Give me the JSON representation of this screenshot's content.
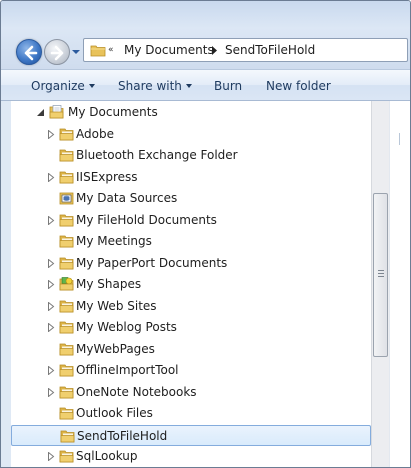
{
  "address": {
    "segments": [
      "My Documents",
      "SendToFileHold"
    ]
  },
  "toolbar": {
    "organize": "Organize",
    "share_with": "Share with",
    "burn": "Burn",
    "new_folder": "New folder"
  },
  "tree": {
    "root": "My Documents",
    "items": [
      {
        "label": "Adobe",
        "expandable": true,
        "icon": "folder-icon"
      },
      {
        "label": "Bluetooth Exchange Folder",
        "expandable": false,
        "icon": "folder-icon"
      },
      {
        "label": "IISExpress",
        "expandable": true,
        "icon": "folder-icon"
      },
      {
        "label": "My Data Sources",
        "expandable": false,
        "icon": "data-sources-icon"
      },
      {
        "label": "My FileHold Documents",
        "expandable": true,
        "icon": "folder-icon"
      },
      {
        "label": "My Meetings",
        "expandable": false,
        "icon": "folder-icon"
      },
      {
        "label": "My PaperPort Documents",
        "expandable": true,
        "icon": "folder-icon"
      },
      {
        "label": "My Shapes",
        "expandable": true,
        "icon": "shapes-folder-icon"
      },
      {
        "label": "My Web Sites",
        "expandable": true,
        "icon": "folder-icon"
      },
      {
        "label": "My Weblog Posts",
        "expandable": true,
        "icon": "folder-icon"
      },
      {
        "label": "MyWebPages",
        "expandable": false,
        "icon": "folder-icon"
      },
      {
        "label": "OfflineImportTool",
        "expandable": true,
        "icon": "folder-icon"
      },
      {
        "label": "OneNote Notebooks",
        "expandable": true,
        "icon": "folder-icon"
      },
      {
        "label": "Outlook Files",
        "expandable": false,
        "icon": "folder-icon"
      },
      {
        "label": "SendToFileHold",
        "expandable": false,
        "icon": "folder-icon",
        "selected": true
      },
      {
        "label": "SqlLookup",
        "expandable": true,
        "icon": "folder-icon"
      }
    ]
  },
  "colors": {
    "selection_border": "#84acdd",
    "selection_fill": "#d9ebfc",
    "folder": "#e8c25a"
  }
}
